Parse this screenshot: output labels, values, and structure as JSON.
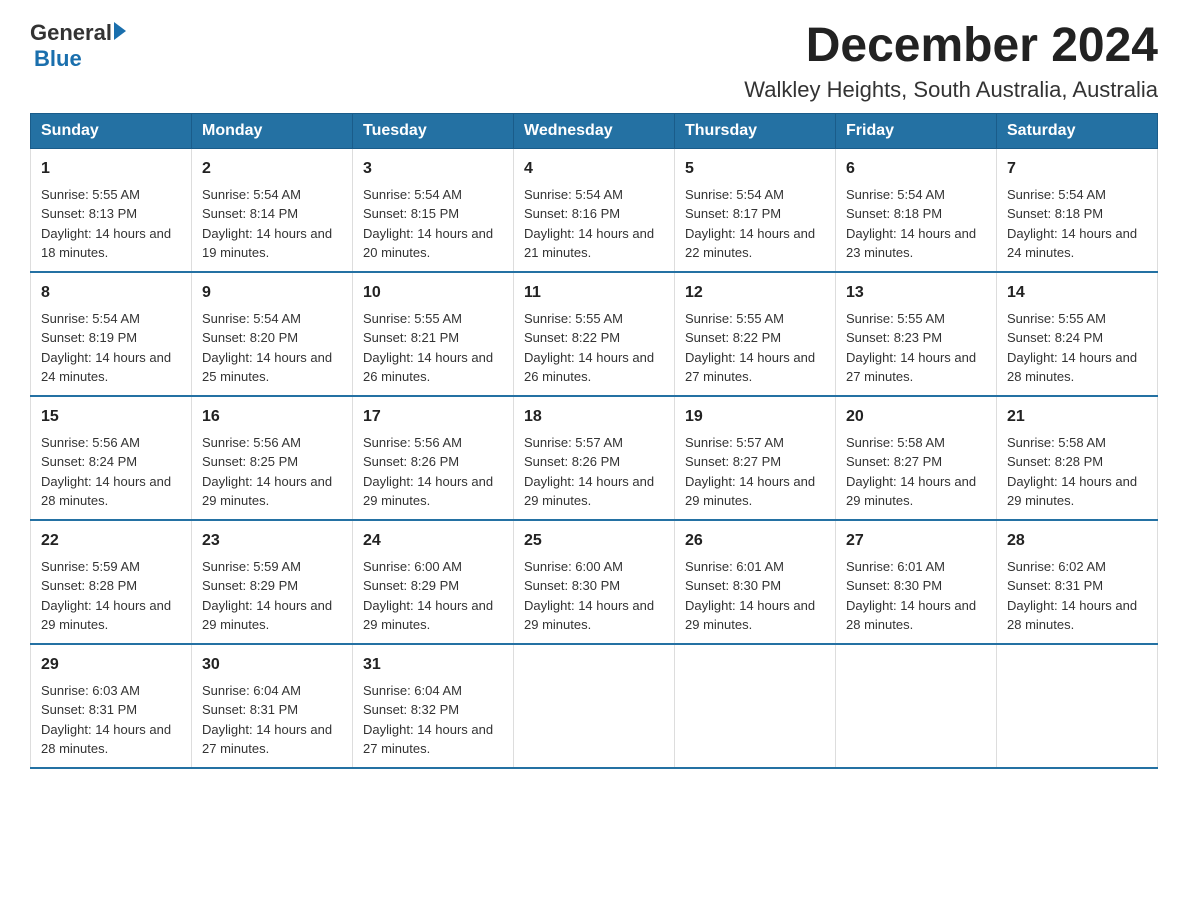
{
  "header": {
    "logo": {
      "text_general": "General",
      "text_blue": "Blue",
      "aria": "GeneralBlue logo"
    },
    "title": "December 2024",
    "subtitle": "Walkley Heights, South Australia, Australia"
  },
  "calendar": {
    "weekdays": [
      "Sunday",
      "Monday",
      "Tuesday",
      "Wednesday",
      "Thursday",
      "Friday",
      "Saturday"
    ],
    "weeks": [
      [
        {
          "day": "1",
          "sunrise": "5:55 AM",
          "sunset": "8:13 PM",
          "daylight": "14 hours and 18 minutes."
        },
        {
          "day": "2",
          "sunrise": "5:54 AM",
          "sunset": "8:14 PM",
          "daylight": "14 hours and 19 minutes."
        },
        {
          "day": "3",
          "sunrise": "5:54 AM",
          "sunset": "8:15 PM",
          "daylight": "14 hours and 20 minutes."
        },
        {
          "day": "4",
          "sunrise": "5:54 AM",
          "sunset": "8:16 PM",
          "daylight": "14 hours and 21 minutes."
        },
        {
          "day": "5",
          "sunrise": "5:54 AM",
          "sunset": "8:17 PM",
          "daylight": "14 hours and 22 minutes."
        },
        {
          "day": "6",
          "sunrise": "5:54 AM",
          "sunset": "8:18 PM",
          "daylight": "14 hours and 23 minutes."
        },
        {
          "day": "7",
          "sunrise": "5:54 AM",
          "sunset": "8:18 PM",
          "daylight": "14 hours and 24 minutes."
        }
      ],
      [
        {
          "day": "8",
          "sunrise": "5:54 AM",
          "sunset": "8:19 PM",
          "daylight": "14 hours and 24 minutes."
        },
        {
          "day": "9",
          "sunrise": "5:54 AM",
          "sunset": "8:20 PM",
          "daylight": "14 hours and 25 minutes."
        },
        {
          "day": "10",
          "sunrise": "5:55 AM",
          "sunset": "8:21 PM",
          "daylight": "14 hours and 26 minutes."
        },
        {
          "day": "11",
          "sunrise": "5:55 AM",
          "sunset": "8:22 PM",
          "daylight": "14 hours and 26 minutes."
        },
        {
          "day": "12",
          "sunrise": "5:55 AM",
          "sunset": "8:22 PM",
          "daylight": "14 hours and 27 minutes."
        },
        {
          "day": "13",
          "sunrise": "5:55 AM",
          "sunset": "8:23 PM",
          "daylight": "14 hours and 27 minutes."
        },
        {
          "day": "14",
          "sunrise": "5:55 AM",
          "sunset": "8:24 PM",
          "daylight": "14 hours and 28 minutes."
        }
      ],
      [
        {
          "day": "15",
          "sunrise": "5:56 AM",
          "sunset": "8:24 PM",
          "daylight": "14 hours and 28 minutes."
        },
        {
          "day": "16",
          "sunrise": "5:56 AM",
          "sunset": "8:25 PM",
          "daylight": "14 hours and 29 minutes."
        },
        {
          "day": "17",
          "sunrise": "5:56 AM",
          "sunset": "8:26 PM",
          "daylight": "14 hours and 29 minutes."
        },
        {
          "day": "18",
          "sunrise": "5:57 AM",
          "sunset": "8:26 PM",
          "daylight": "14 hours and 29 minutes."
        },
        {
          "day": "19",
          "sunrise": "5:57 AM",
          "sunset": "8:27 PM",
          "daylight": "14 hours and 29 minutes."
        },
        {
          "day": "20",
          "sunrise": "5:58 AM",
          "sunset": "8:27 PM",
          "daylight": "14 hours and 29 minutes."
        },
        {
          "day": "21",
          "sunrise": "5:58 AM",
          "sunset": "8:28 PM",
          "daylight": "14 hours and 29 minutes."
        }
      ],
      [
        {
          "day": "22",
          "sunrise": "5:59 AM",
          "sunset": "8:28 PM",
          "daylight": "14 hours and 29 minutes."
        },
        {
          "day": "23",
          "sunrise": "5:59 AM",
          "sunset": "8:29 PM",
          "daylight": "14 hours and 29 minutes."
        },
        {
          "day": "24",
          "sunrise": "6:00 AM",
          "sunset": "8:29 PM",
          "daylight": "14 hours and 29 minutes."
        },
        {
          "day": "25",
          "sunrise": "6:00 AM",
          "sunset": "8:30 PM",
          "daylight": "14 hours and 29 minutes."
        },
        {
          "day": "26",
          "sunrise": "6:01 AM",
          "sunset": "8:30 PM",
          "daylight": "14 hours and 29 minutes."
        },
        {
          "day": "27",
          "sunrise": "6:01 AM",
          "sunset": "8:30 PM",
          "daylight": "14 hours and 28 minutes."
        },
        {
          "day": "28",
          "sunrise": "6:02 AM",
          "sunset": "8:31 PM",
          "daylight": "14 hours and 28 minutes."
        }
      ],
      [
        {
          "day": "29",
          "sunrise": "6:03 AM",
          "sunset": "8:31 PM",
          "daylight": "14 hours and 28 minutes."
        },
        {
          "day": "30",
          "sunrise": "6:04 AM",
          "sunset": "8:31 PM",
          "daylight": "14 hours and 27 minutes."
        },
        {
          "day": "31",
          "sunrise": "6:04 AM",
          "sunset": "8:32 PM",
          "daylight": "14 hours and 27 minutes."
        },
        null,
        null,
        null,
        null
      ]
    ]
  }
}
